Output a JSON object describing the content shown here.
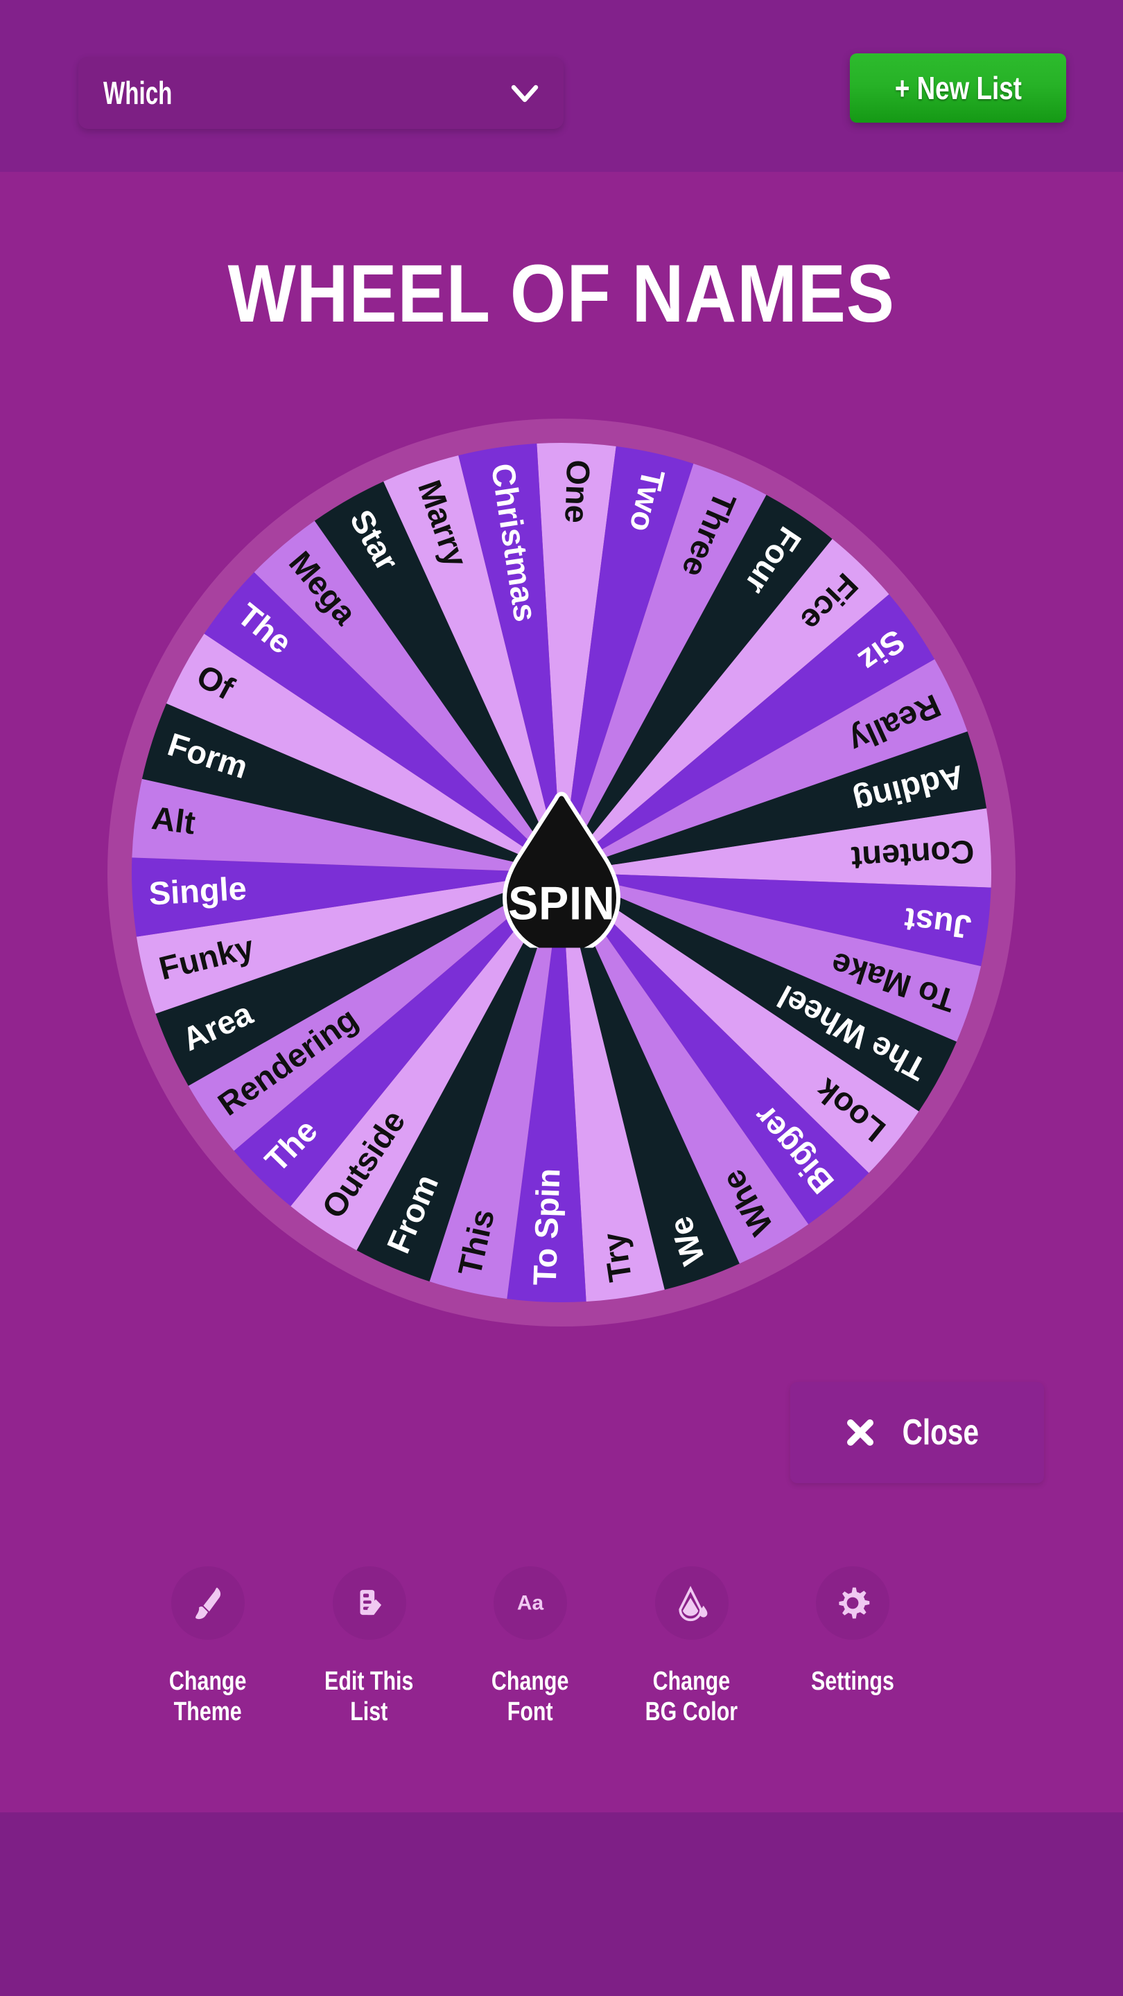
{
  "header": {
    "list_selector": {
      "value": "Which",
      "icon": "chevron-down-icon"
    },
    "new_list_button": {
      "label": "+ New List",
      "color": "#27B227"
    }
  },
  "page_title": "WHEEL OF NAMES",
  "wheel": {
    "spin_label": "SPIN",
    "segment_colors": [
      "#DDA0F5",
      "#7B2FD6",
      "#C27AEA",
      "#0F2027"
    ],
    "rim_color": "#A8419F",
    "hub_color": "#111111",
    "segments": [
      "One",
      "Two",
      "Three",
      "Four",
      "Fice",
      "Siz",
      "Really",
      "Adding",
      "Content",
      "Just",
      "To Make",
      "The Wheel",
      "Look",
      "Bigger",
      "Whe",
      "We",
      "Try",
      "To Spin",
      "This",
      "From",
      "Outside",
      "The",
      "Rendering",
      "Area",
      "Funky",
      "Single",
      "Alt",
      "Form",
      "Of",
      "The",
      "Mega",
      "Star",
      "Marry",
      "Christmas"
    ]
  },
  "close_button": {
    "label": "Close",
    "icon": "close-x-icon"
  },
  "toolbar": {
    "items": [
      {
        "label": "Change\nTheme",
        "icon": "paintbrush-icon"
      },
      {
        "label": "Edit This\nList",
        "icon": "edit-list-icon"
      },
      {
        "label": "Change\nFont",
        "icon": "font-aa-icon"
      },
      {
        "label": "Change\nBG Color",
        "icon": "paint-bucket-icon"
      },
      {
        "label": "Settings",
        "icon": "gear-icon"
      }
    ]
  },
  "colors": {
    "header_bg": "#82218B",
    "body_bg": "#92248F",
    "footer_bg": "#7E1F86",
    "accent_green": "#27B227"
  }
}
